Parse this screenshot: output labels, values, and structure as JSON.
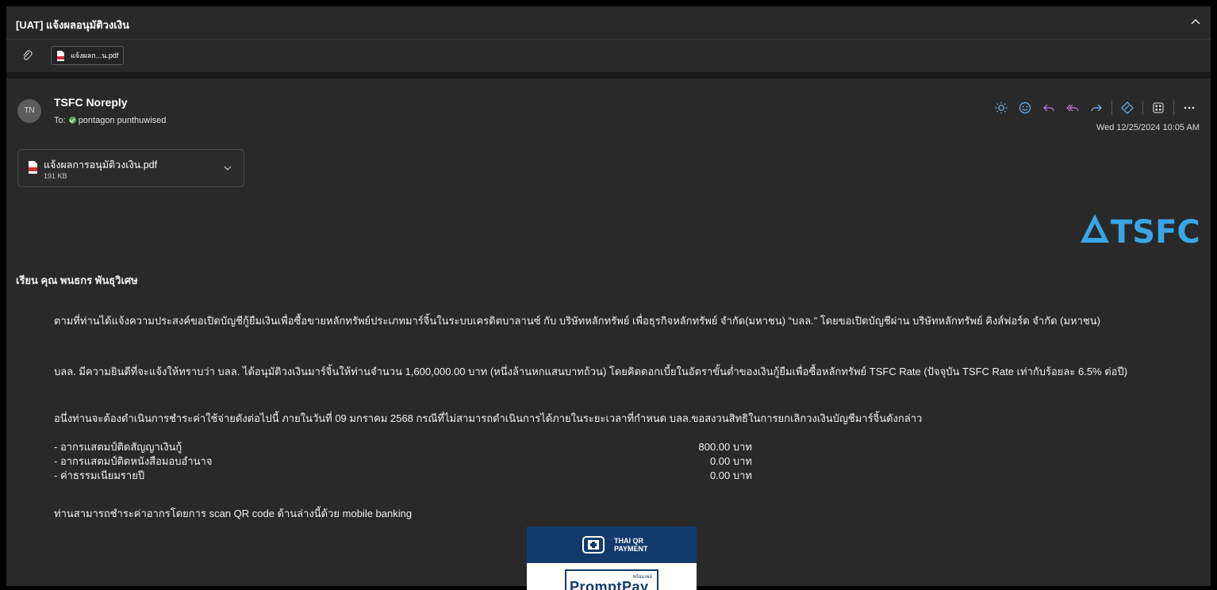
{
  "email": {
    "subject": "[UAT] แจ้งผลอนุมัติวงเงิน",
    "top_attachment_chip": "แจ้งผลก...น.pdf",
    "sender_initials": "TN",
    "sender_name": "TSFC Noreply",
    "to_label": "To:",
    "to_name": "pontagon punthuwised",
    "date": "Wed 12/25/2024 10:05 AM",
    "attachment": {
      "name": "แจ้งผลการอนุมัติวงเงิน.pdf",
      "size": "191 KB"
    }
  },
  "toolbar_icons": [
    "sun-icon",
    "emoji-icon",
    "reply-icon",
    "reply-all-icon",
    "forward-icon",
    "loop-icon",
    "apps-icon",
    "more-icon"
  ],
  "body": {
    "logo_text": "TSFC",
    "greeting": "เรียน คุณ พนธกร พันธุวิเศษ",
    "paragraph1": "ตามที่ท่านได้แจ้งความประสงค์ขอเปิดบัญชีกู้ยืมเงินเพื่อซื้อขายหลักทรัพย์ประเภทมาร์จิ้นในระบบเครดิตบาลานซ์ กับ บริษัทหลักทรัพย์ เพื่อธุรกิจหลักทรัพย์ จำกัด(มหาชน) “บลล.” โดยขอเปิดบัญชีผ่าน บริษัทหลักทรัพย์ คิงส์ฟอร์ด จำกัด (มหาชน)",
    "paragraph2": "บลล. มีความยินดีที่จะแจ้งให้ทราบว่า บลล. ได้อนุมัติวงเงินมาร์จิ้นให้ท่านจำนวน 1,600,000.00 บาท (หนึ่งล้านหกแสนบาทถ้วน) โดยคิดดอกเบี้ยในอัตราขั้นต่ำของเงินกู้ยืมเพื่อซื้อหลักทรัพย์ TSFC Rate (ปัจจุบัน TSFC Rate เท่ากับร้อยละ 6.5% ต่อปี)",
    "paragraph3": "อนึ่งท่านจะต้องดำเนินการชำระค่าใช้จ่ายดังต่อไปนี้ ภายในวันที่ 09 มกราคม 2568 กรณีที่ไม่สามารถดำเนินการได้ภายในระยะเวลาที่กำหนด บลล.ขอสงวนสิทธิในการยกเลิกวงเงินบัญชีมาร์จิ้นดังกล่าว",
    "fees": [
      {
        "label": "- อากรแสตมป์ติดสัญญาเงินกู้",
        "amount": "800.00 บาท"
      },
      {
        "label": "- อากรแสตมป์ติดหนังสือมอบอำนาจ",
        "amount": "0.00 บาท"
      },
      {
        "label": "- ค่าธรรมเนียมรายปี",
        "amount": "0.00 บาท"
      }
    ],
    "paragraph4": "ท่านสามารถชำระค่าอากรโดยการ scan QR code ด้านล่างนี้ด้วย mobile banking",
    "qr": {
      "title_line1": "THAI QR",
      "title_line2": "PAYMENT",
      "promptpay_small": "พร้อมเพย์",
      "promptpay": "PromptPay"
    }
  },
  "colors": {
    "background": "#292929",
    "accent_icons": "#6cb8f6",
    "reply_icons": "#c678dd",
    "presence": "#4caf50",
    "logo": "#38a6e6",
    "qr_header": "#123a6b"
  }
}
